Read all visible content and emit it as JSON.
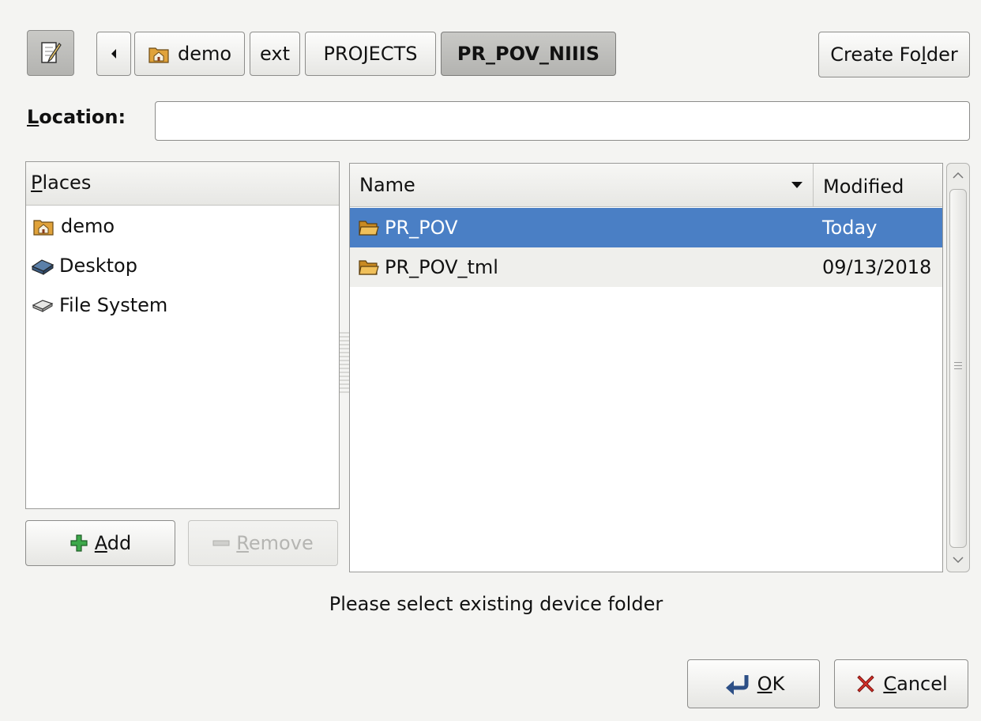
{
  "toolbar": {
    "path_buttons": [
      "demo",
      "ext",
      "PROJECTS",
      "PR_POV_NIIIS"
    ],
    "create_folder": {
      "pre": "Create Fo",
      "u": "l",
      "post": "der"
    }
  },
  "location": {
    "label_u": "L",
    "label_rest": "ocation:",
    "value": ""
  },
  "places": {
    "header_u": "P",
    "header_rest": "laces",
    "items": [
      {
        "label": "demo",
        "icon": "home-folder-icon"
      },
      {
        "label": "Desktop",
        "icon": "desktop-icon"
      },
      {
        "label": "File System",
        "icon": "drive-icon"
      }
    ],
    "add_button": {
      "u": "A",
      "rest": "dd"
    },
    "remove_button": {
      "u": "R",
      "rest": "emove"
    }
  },
  "files": {
    "col_name": "Name",
    "col_modified": "Modified",
    "rows": [
      {
        "name": "PR_POV",
        "modified": "Today",
        "selected": true
      },
      {
        "name": "PR_POV_tml",
        "modified": "09/13/2018",
        "selected": false
      }
    ]
  },
  "status_message": "Please select existing device folder",
  "footer": {
    "ok": {
      "u": "O",
      "rest": "K"
    },
    "cancel": {
      "u": "C",
      "rest": "ancel"
    }
  },
  "colors": {
    "selection": "#4a7fc5",
    "dialog_bg": "#f4f4f2"
  }
}
